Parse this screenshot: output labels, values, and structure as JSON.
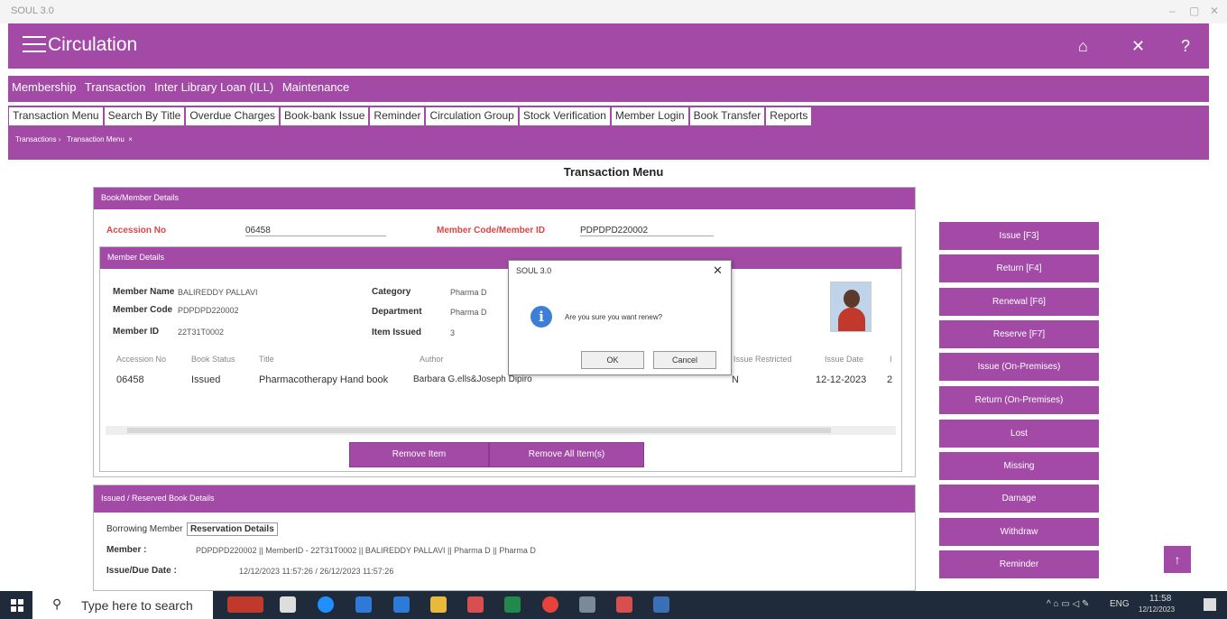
{
  "window": {
    "title": "SOUL 3.0",
    "minimize": "–",
    "maximize": "▢",
    "close": "✕"
  },
  "appbar": {
    "title": "Circulation",
    "home_icon": "home-icon",
    "close_icon": "close-icon",
    "help_icon": "help-icon"
  },
  "mainmenu": [
    "Membership",
    "Transaction",
    "Inter Library Loan (ILL)",
    "Maintenance"
  ],
  "submenu": [
    "Transaction Menu",
    "Search By Title",
    "Overdue Charges",
    "Book-bank Issue",
    "Reminder",
    "Circulation Group",
    "Stock Verification",
    "Member Login",
    "Book Transfer",
    "Reports"
  ],
  "breadcrumb": {
    "item1": "Transactions ›",
    "item2": "Transaction Menu",
    "close": "×"
  },
  "page_title": "Transaction Menu",
  "book_member": {
    "header": "Book/Member Details",
    "accession_label": "Accession No",
    "accession_value": "06458",
    "member_code_label": "Member Code/Member ID",
    "member_code_value": "PDPDPD220002"
  },
  "member_details": {
    "header": "Member Details",
    "name_label": "Member Name",
    "name_value": "BALIREDDY PALLAVI",
    "code_label": "Member Code",
    "code_value": "PDPDPD220002",
    "id_label": "Member ID",
    "id_value": "22T31T0002",
    "category_label": "Category",
    "category_value": "Pharma D",
    "department_label": "Department",
    "department_value": "Pharma D",
    "issued_label": "Item Issued",
    "issued_value": "3"
  },
  "table": {
    "headers": [
      "Accession No",
      "Book Status",
      "Title",
      "Author",
      "Issue Restricted",
      "Issue Date",
      "I"
    ],
    "row": {
      "accession": "06458",
      "status": "Issued",
      "title": "Pharmacotherapy Hand book",
      "author": "Barbara G.ells&Joseph Dipiro",
      "restricted": "N",
      "issue_date": "12-12-2023",
      "extra": "2"
    }
  },
  "buttons": {
    "remove_item": "Remove Item",
    "remove_all": "Remove All Item(s)"
  },
  "dialog": {
    "title": "SOUL 3.0",
    "close": "✕",
    "message": "Are you sure you want renew?",
    "ok": "OK",
    "cancel": "Cancel"
  },
  "side_buttons": [
    "Issue [F3]",
    "Return [F4]",
    "Renewal [F6]",
    "Reserve [F7]",
    "Issue (On-Premises)",
    "Return (On-Premises)",
    "Lost",
    "Missing",
    "Damage",
    "Withdraw",
    "Reminder"
  ],
  "issued_panel": {
    "header": "Issued / Reserved Book Details",
    "tab1": "Borrowing Member",
    "tab2": "Reservation Details",
    "member_label": "Member :",
    "member_value": "PDPDPD220002 || MemberID - 22T31T0002 || BALIREDDY PALLAVI || Pharma D || Pharma D",
    "dates_label": "Issue/Due Date :",
    "dates_value": "12/12/2023 11:57:26 / 26/12/2023 11:57:26"
  },
  "scroll_top": "↑",
  "taskbar": {
    "search_placeholder": "Type here to search",
    "lang": "ENG",
    "time": "11:58",
    "date": "12/12/2023"
  },
  "colors": {
    "brand": "#a24aa6",
    "accent_red": "#dd4444",
    "info": "#3d7fd6"
  }
}
